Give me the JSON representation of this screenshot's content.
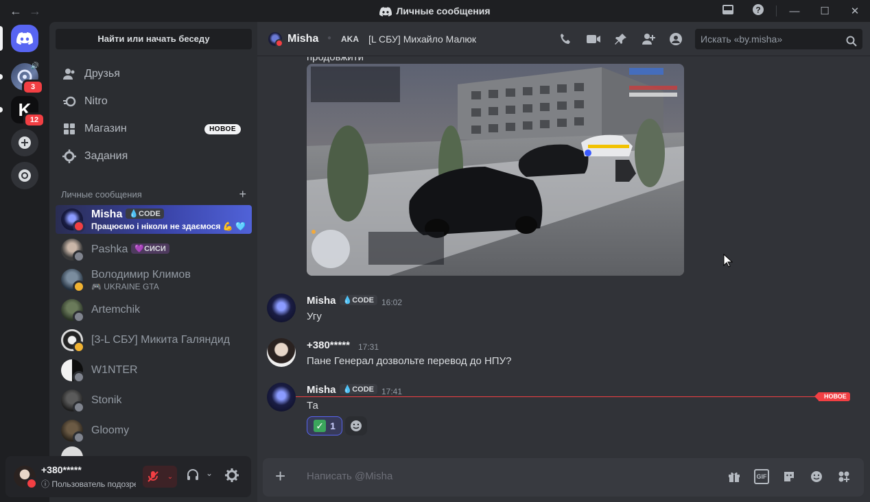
{
  "window": {
    "title": "Личные сообщения",
    "back_icon": "arrow-left-icon",
    "forward_icon": "arrow-right-icon"
  },
  "rail": {
    "servers": [
      {
        "name": "server-1",
        "badge": "3"
      },
      {
        "name": "server-k",
        "badge": "12",
        "letter": "K"
      }
    ]
  },
  "sidebar": {
    "find_label": "Найти или начать беседу",
    "nav": [
      {
        "label": "Друзья",
        "icon": "friends-icon"
      },
      {
        "label": "Nitro",
        "icon": "nitro-icon"
      },
      {
        "label": "Магазин",
        "icon": "shop-icon",
        "badge": "НОВОЕ"
      },
      {
        "label": "Задания",
        "icon": "quests-icon"
      }
    ],
    "dm_header": "Личные сообщения",
    "dms": [
      {
        "name": "Misha",
        "tag": "CODE",
        "sub": "Працюємо і ніколи не здаємося 💪 🩵",
        "status": "dnd"
      },
      {
        "name": "Pashka",
        "tag": "СИСИ",
        "sub": "",
        "status": "offline"
      },
      {
        "name": "Володимир Климов",
        "tag": "",
        "sub": "🎮 UKRAINE GTA",
        "status": "idle"
      },
      {
        "name": "Artemchik",
        "tag": "",
        "sub": "",
        "status": "offline"
      },
      {
        "name": "[3-L СБУ] Микита Галяндид",
        "tag": "",
        "sub": "",
        "status": "idle"
      },
      {
        "name": "W1NTER",
        "tag": "",
        "sub": "",
        "status": "offline"
      },
      {
        "name": "Stonik",
        "tag": "",
        "sub": "",
        "status": "offline"
      },
      {
        "name": "Gloomy",
        "tag": "",
        "sub": "",
        "status": "offline"
      }
    ]
  },
  "user": {
    "name": "+380*****",
    "status_text": "Пользователь подозре"
  },
  "chat": {
    "name": "Misha",
    "aka_label": "AKA",
    "nick": "[L СБУ] Михайло Малюк",
    "search_placeholder": "Искать «by.misha»",
    "continuation": "продовжити",
    "messages": [
      {
        "author": "Misha",
        "tag": "CODE",
        "time": "16:02",
        "text": "Угу"
      },
      {
        "author": "+380*****",
        "tag": "",
        "time": "17:31",
        "text": "Пане Генерал дозвольте перевод до НПУ?"
      },
      {
        "author": "Misha",
        "tag": "CODE",
        "time": "17:41",
        "text": "Та"
      }
    ],
    "new_divider": "НОВОЕ",
    "reaction_count": "1",
    "composer_placeholder": "Написать @Misha"
  },
  "colors": {
    "accent": "#5865f2",
    "danger": "#f23f43",
    "background": "#313338",
    "sidebar": "#2b2d31"
  }
}
